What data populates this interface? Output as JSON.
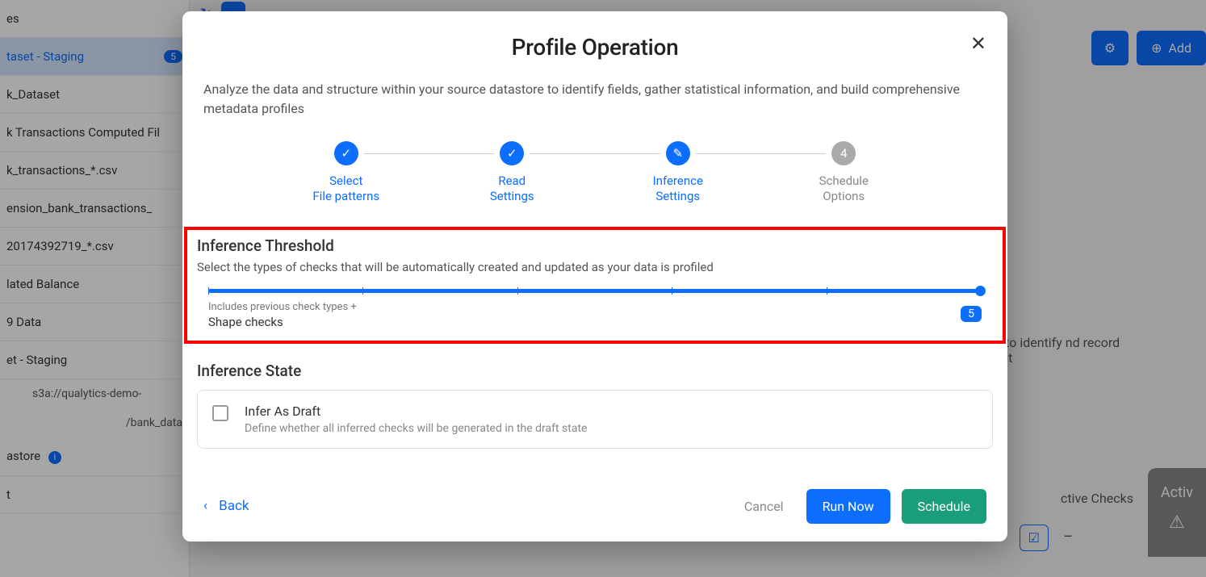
{
  "sidebar": {
    "items": [
      {
        "label": "es"
      },
      {
        "label": "taset - Staging",
        "badge": "5",
        "active": true
      },
      {
        "label": "k_Dataset"
      },
      {
        "label": "k Transactions Computed Fil"
      },
      {
        "label": "k_transactions_*.csv"
      },
      {
        "label": "ension_bank_transactions_"
      },
      {
        "label": "20174392719_*.csv"
      },
      {
        "label": "lated Balance"
      },
      {
        "label": "9 Data"
      },
      {
        "label": "et - Staging"
      }
    ],
    "path1": "s3a://qualytics-demo-",
    "path2": "/bank_data",
    "astore": "astore",
    "t": "t"
  },
  "header": {
    "add": "Add"
  },
  "right": {
    "text": "ty checks to identify nd record enrichment",
    "active_checks": "ctive Checks",
    "side_tab": "Activ"
  },
  "modal": {
    "title": "Profile Operation",
    "desc": "Analyze the data and structure within your source datastore to identify fields, gather statistical information, and build comprehensive metadata profiles",
    "steps": [
      {
        "line1": "Select",
        "line2": "File patterns",
        "state": "done"
      },
      {
        "line1": "Read",
        "line2": "Settings",
        "state": "done"
      },
      {
        "line1": "Inference",
        "line2": "Settings",
        "state": "current"
      },
      {
        "line1": "Schedule",
        "line2": "Options",
        "state": "pending",
        "num": "4"
      }
    ],
    "inference_threshold": {
      "title": "Inference Threshold",
      "desc": "Select the types of checks that will be automatically created and updated as your data is profiled",
      "caption": "Includes previous check types +",
      "label": "Shape checks",
      "value": "5"
    },
    "inference_state": {
      "title": "Inference State",
      "draft_title": "Infer As Draft",
      "draft_desc": "Define whether all inferred checks will be generated in the draft state"
    },
    "footer": {
      "back": "Back",
      "cancel": "Cancel",
      "run": "Run Now",
      "schedule": "Schedule"
    }
  }
}
